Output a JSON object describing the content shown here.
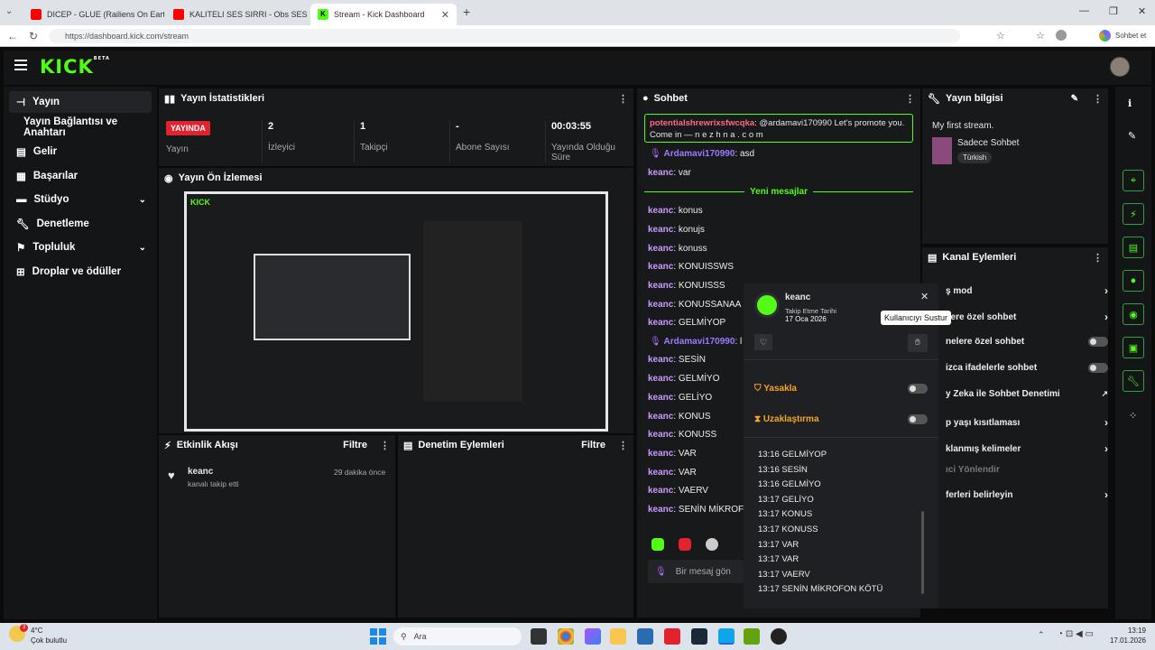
{
  "browser": {
    "tabs": [
      {
        "title": "DICEP - GLUE (Railiens On Earth Re",
        "color": "#ff0000"
      },
      {
        "title": "KALITELI SES SIRRI - Obs SES AYARI",
        "color": "#ff0000"
      },
      {
        "title": "Stream - Kick Dashboard",
        "color": "#53fc18"
      }
    ],
    "url": "https://dashboard.kick.com/stream",
    "profile": "Sohbet et"
  },
  "app": {
    "logo": "KICK",
    "beta": "BETA"
  },
  "sidebar": {
    "items": [
      {
        "label": "Yayın",
        "icon": "broadcast-icon"
      },
      {
        "label": "Yayın Bağlantısı ve Anahtarı",
        "icon": ""
      },
      {
        "label": "Gelir",
        "icon": "revenue-icon"
      },
      {
        "label": "Başarılar",
        "icon": "achievements-icon"
      },
      {
        "label": "Stüdyo",
        "icon": "studio-icon"
      },
      {
        "label": "Denetleme",
        "icon": "wrench-icon"
      },
      {
        "label": "Topluluk",
        "icon": "community-icon"
      },
      {
        "label": "Droplar ve ödüller",
        "icon": "drops-icon"
      }
    ]
  },
  "stats": {
    "title": "Yayın İstatistikleri",
    "live_badge": "YAYINDA",
    "live_label": "Yayın",
    "viewers": "2",
    "viewers_label": "İzleyici",
    "followers": "1",
    "followers_label": "Takipçi",
    "subs": "-",
    "subs_label": "Abone Sayısı",
    "uptime": "00:03:55",
    "uptime_label": "Yayında Olduğu Süre"
  },
  "preview": {
    "title": "Yayın Ön İzlemesi"
  },
  "activity": {
    "title": "Etkinlik Akışı",
    "filter": "Filtre",
    "user": "keanc",
    "text": "kanalı takip etti",
    "time": "29 dakika önce"
  },
  "moderation": {
    "title": "Denetim Eylemleri",
    "filter": "Filtre"
  },
  "chat": {
    "title": "Sohbet",
    "pinned_user": "potentialshrewrixsfwcqka",
    "pinned_msg": "@ardamavi170990 Let's promote you. Come in — n e z h n a . c o m",
    "new_messages": "Yeni mesajlar",
    "input_placeholder": "Bir mesaj gön",
    "messages": [
      {
        "user": "Ardamavi170990",
        "text": "asd"
      },
      {
        "user": "keanc",
        "text": "var"
      },
      {
        "user": "keanc",
        "text": "konus"
      },
      {
        "user": "keanc",
        "text": "konujs"
      },
      {
        "user": "keanc",
        "text": "konuss"
      },
      {
        "user": "keanc",
        "text": "KONUISSWS"
      },
      {
        "user": "keanc",
        "text": "KONUISSS"
      },
      {
        "user": "keanc",
        "text": "KONUSSANAA"
      },
      {
        "user": "keanc",
        "text": "GELMİYOP"
      },
      {
        "user": "Ardamavi170990",
        "text": "l"
      },
      {
        "user": "keanc",
        "text": "SESİN"
      },
      {
        "user": "keanc",
        "text": "GELMİYO"
      },
      {
        "user": "keanc",
        "text": "GELİYO"
      },
      {
        "user": "keanc",
        "text": "KONUS"
      },
      {
        "user": "keanc",
        "text": "KONUSS"
      },
      {
        "user": "keanc",
        "text": "VAR"
      },
      {
        "user": "keanc",
        "text": "VAR"
      },
      {
        "user": "keanc",
        "text": "VAERV"
      },
      {
        "user": "keanc",
        "text": "SENİN MİKROF"
      }
    ]
  },
  "stream_info": {
    "title": "Yayın bilgisi",
    "stream_title": "My first stream.",
    "category": "Sadece Sohbet",
    "language": "Türkish"
  },
  "channel_actions": {
    "title": "Kanal Eylemleri",
    "rows": [
      {
        "label": "ş mod",
        "control": "chevron"
      },
      {
        "label": "ilere özel sohbet",
        "control": "chevron"
      },
      {
        "label": "nelere özel sohbet",
        "control": "toggle"
      },
      {
        "label": "izca ifadelerle sohbet",
        "control": "toggle"
      },
      {
        "label": "y Zeka ile Sohbet Denetimi",
        "control": "external"
      },
      {
        "label": "p yaşı kısıtlaması",
        "control": "chevron"
      },
      {
        "label": "klanmış kelimeler",
        "control": "chevron"
      },
      {
        "label": "ıci Yönlendir",
        "control": "none"
      },
      {
        "label": "ferleri belirleyin",
        "control": "chevron"
      }
    ]
  },
  "user_card": {
    "username": "keanc",
    "follow_label": "Takip Etme Tarihi",
    "follow_date": "17 Oca 2026",
    "tooltip": "Kullanıcıyı Sustur",
    "ban": "Yasakla",
    "timeout": "Uzaklaştırma",
    "log": [
      "13:16 GELMİYOP",
      "13:16 SESİN",
      "13:16 GELMİYO",
      "13:17 GELİYO",
      "13:17 KONUS",
      "13:17 KONUSS",
      "13:17 VAR",
      "13:17 VAR",
      "13:17 VAERV",
      "13:17 SENİN MİKROFON KÖTÜ"
    ]
  },
  "taskbar": {
    "weather_temp": "4°C",
    "weather_text": "Çok bulutlu",
    "search": "Ara",
    "time": "13:19",
    "date": "17.01.2026",
    "badge": "3"
  }
}
